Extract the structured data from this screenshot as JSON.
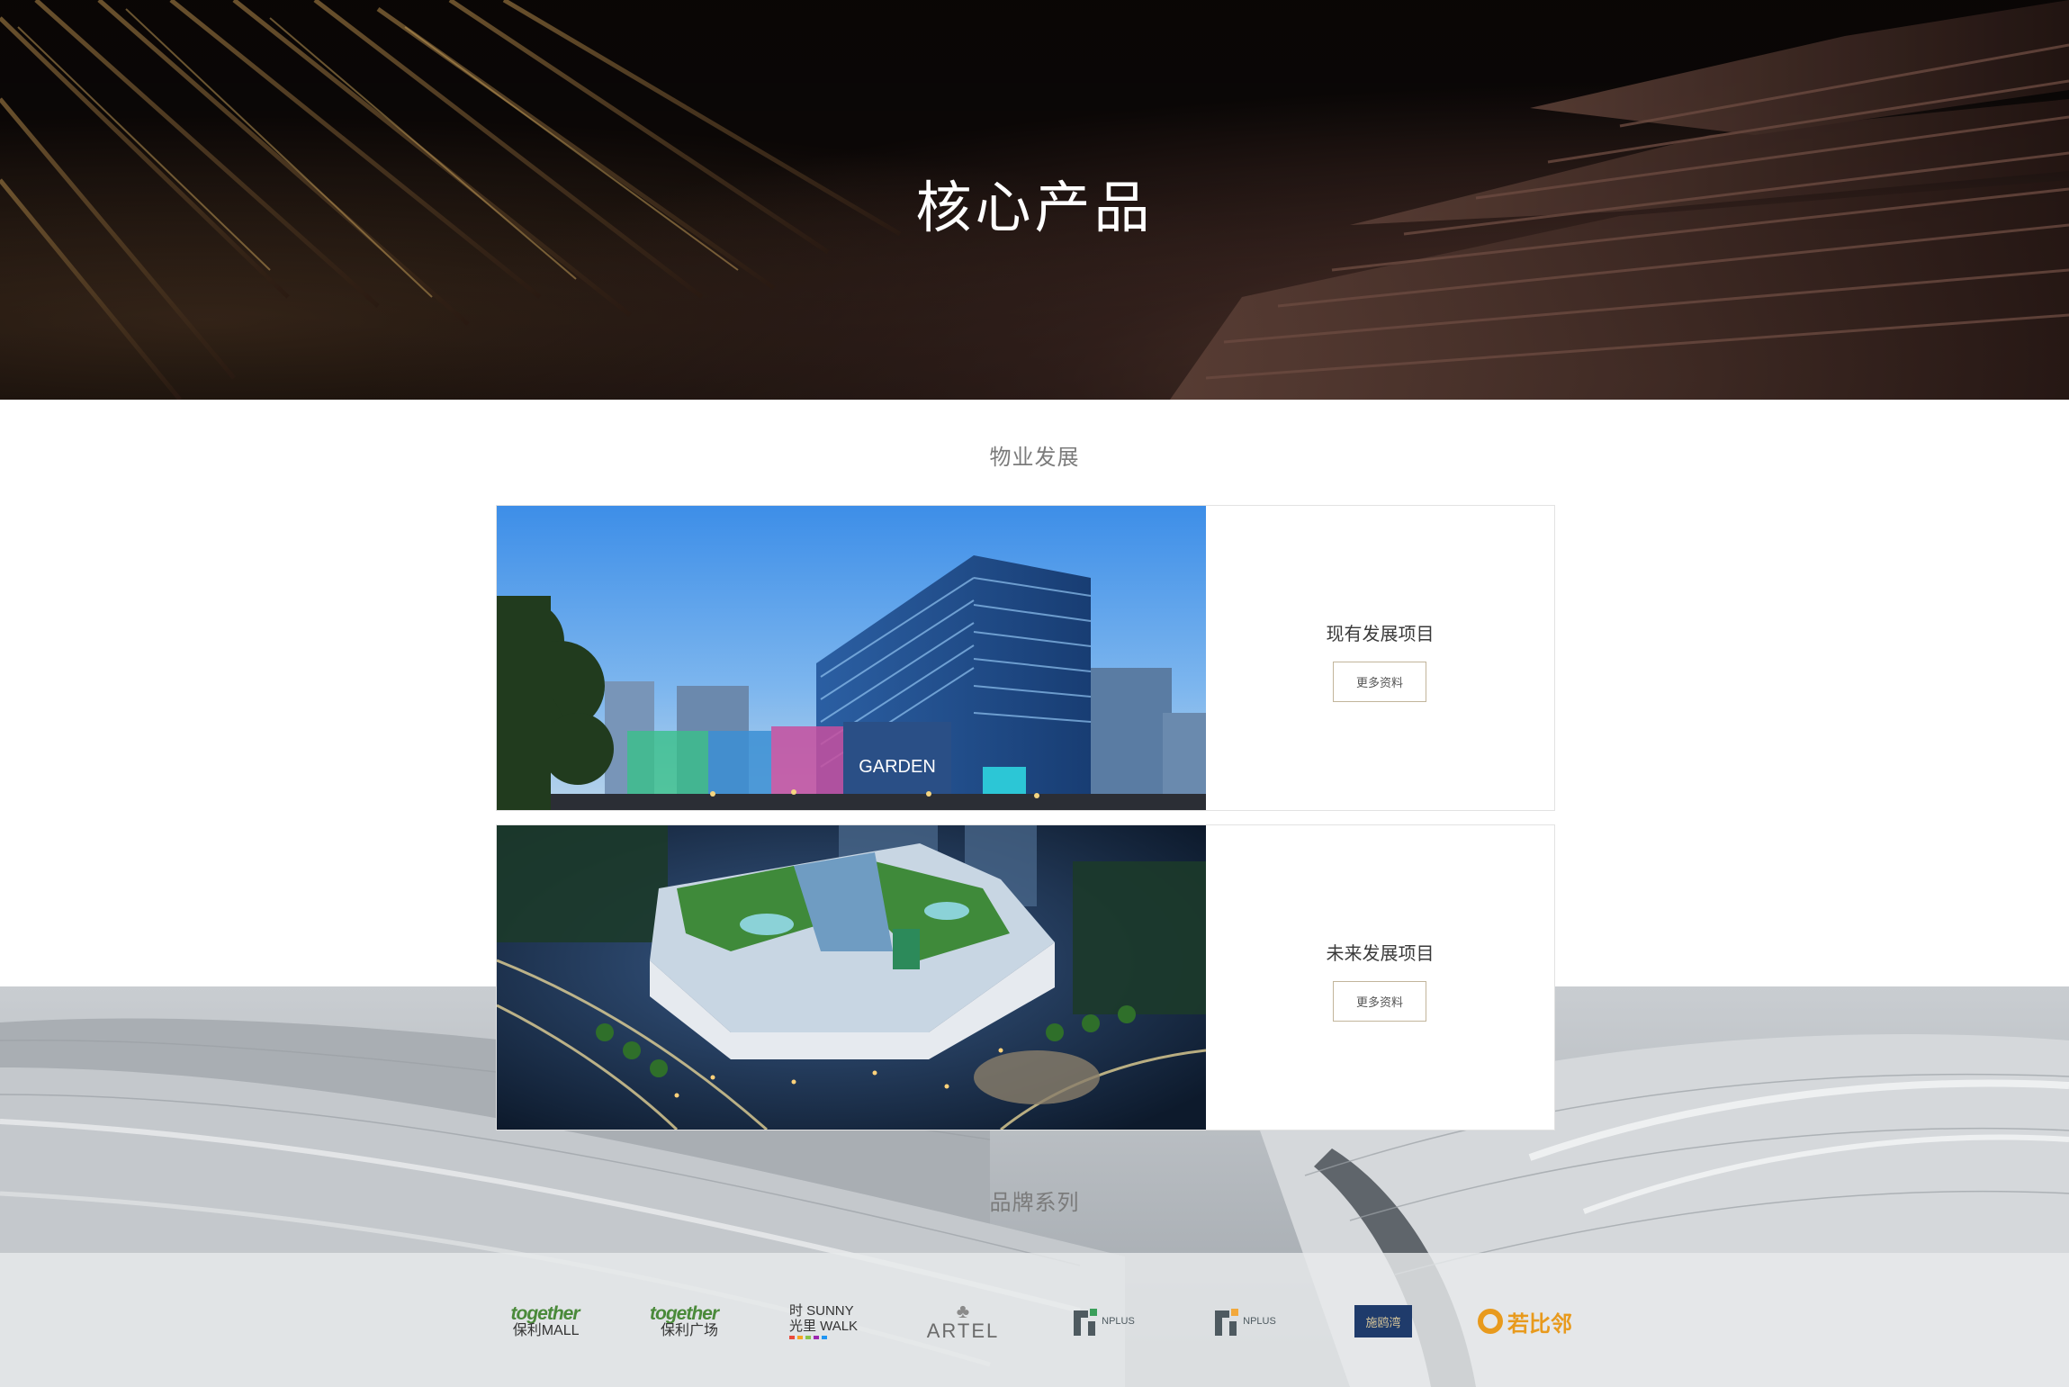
{
  "hero": {
    "title": "核心产品"
  },
  "property": {
    "section_title": "物业发展",
    "cards": [
      {
        "title": "现有发展项目",
        "button": "更多资料",
        "image_sign": "GARDEN"
      },
      {
        "title": "未来发展项目",
        "button": "更多资料"
      }
    ]
  },
  "brands": {
    "section_title": "品牌系列",
    "items": [
      {
        "line1": "together",
        "line2": "保利MALL",
        "color": "#4a8a3a"
      },
      {
        "line1": "together",
        "line2": "保利广场",
        "color": "#4a8a3a"
      },
      {
        "line1": "时 SUNNY",
        "line2": "光里 WALK",
        "color": "#333333"
      },
      {
        "line1": "ARTEL",
        "color": "#6b6b6b"
      },
      {
        "line1": "NPLUS",
        "color": "#4e5a60"
      },
      {
        "line1": "NPLUS",
        "color": "#4e5a60"
      },
      {
        "line1": "施鸥湾",
        "color": "#1f3b6b"
      },
      {
        "line1": "若比邻",
        "color": "#e89a1d"
      }
    ]
  }
}
